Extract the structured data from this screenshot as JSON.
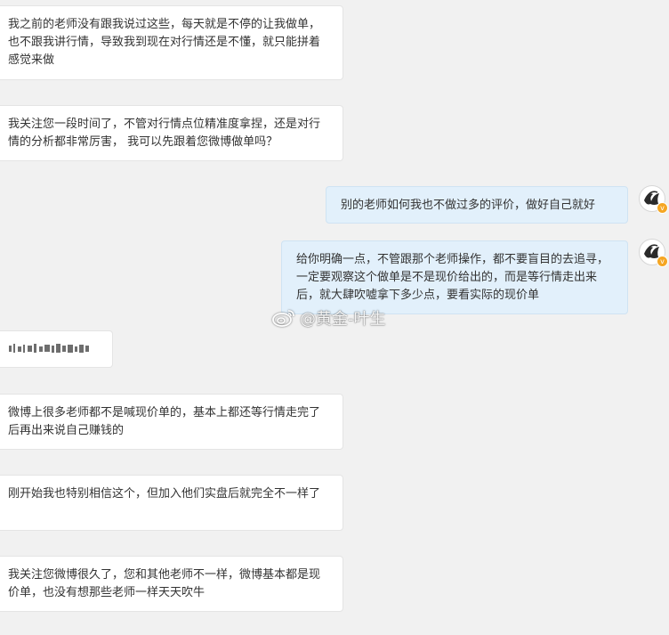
{
  "messages": [
    {
      "side": "left",
      "text": "我之前的老师没有跟我说过这些，每天就是不停的让我做单，也不跟我讲行情，导致我到现在对行情还是不懂，就只能拼着感觉来做"
    },
    {
      "side": "left",
      "text": "我关注您一段时间了，不管对行情点位精准度拿捏，还是对行情的分析都非常厉害， 我可以先跟着您微博做单吗？"
    },
    {
      "side": "right",
      "text": "别的老师如何我也不做过多的评价，做好自己就好"
    },
    {
      "side": "right",
      "text": "给你明确一点，不管跟那个老师操作，都不要盲目的去追寻，一定要观察这个做单是不是现价给出的，而是等行情走出来后，就大肆吹嘘拿下多少点，要看实际的现价单"
    },
    {
      "side": "left",
      "text": "",
      "redacted": true
    },
    {
      "side": "left",
      "text": "微博上很多老师都不是喊现价单的，基本上都还等行情走完了后再出来说自己赚钱的"
    },
    {
      "side": "left",
      "text": "刚开始我也特别相信这个，但加入他们实盘后就完全不一样了"
    },
    {
      "side": "left",
      "text": "我关注您微博很久了，您和其他老师不一样，微博基本都是现价单，也没有想那些老师一样天天吹牛"
    }
  ],
  "watermark": {
    "text": "@黄金-叶生"
  },
  "avatar": {
    "badge": "v"
  },
  "colors": {
    "background": "#f1f1f1",
    "left_bubble": "#ffffff",
    "right_bubble": "#e2f0fb",
    "text": "#333333",
    "badge": "#f5a623"
  }
}
